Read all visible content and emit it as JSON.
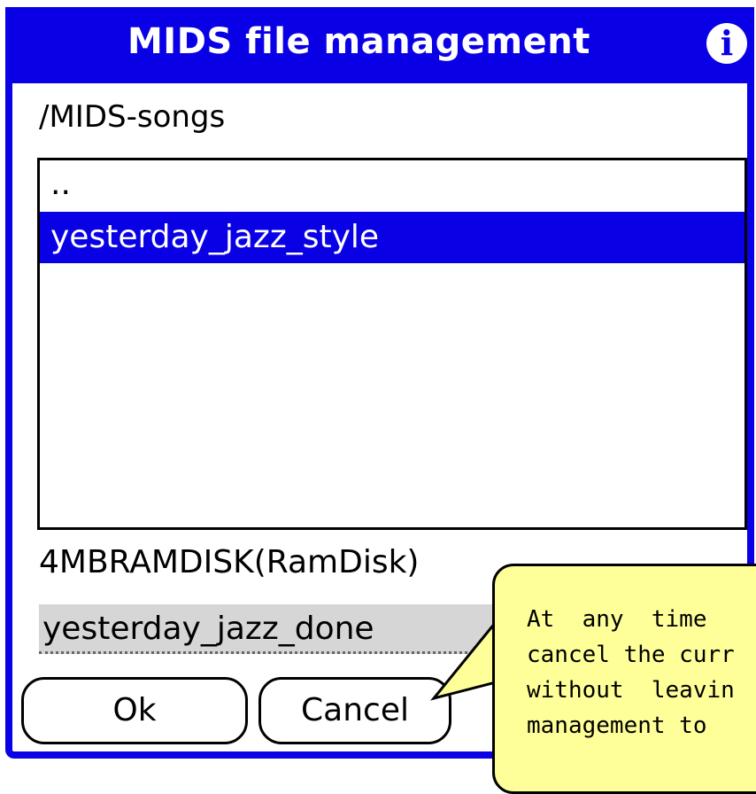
{
  "dialog": {
    "title": "MIDS file management",
    "info_icon": "info-icon"
  },
  "browser": {
    "current_path": "/MIDS-songs",
    "items": [
      {
        "label": "..",
        "selected": false
      },
      {
        "label": "yesterday_jazz_style",
        "selected": true
      }
    ]
  },
  "volume": {
    "label": "4MBRAMDISK(RamDisk)"
  },
  "filename_field": {
    "value": "yesterday_jazz_done"
  },
  "buttons": {
    "ok_label": "Ok",
    "cancel_label": "Cancel"
  },
  "tooltip": {
    "line1": "At  any  time",
    "line2": "cancel the curr",
    "line3": "without  leavin",
    "line4": "management to"
  },
  "colors": {
    "title_bar": "#0a00e6",
    "selection": "#0a00e6",
    "tooltip_bg": "#ffff99",
    "field_bg": "#d6d6d6"
  }
}
